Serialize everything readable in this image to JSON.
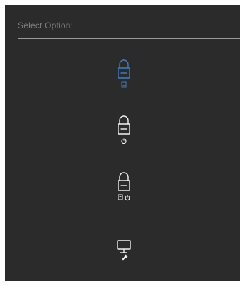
{
  "header": {
    "title": "Select Option:"
  },
  "options": [
    {
      "icon": "lock-menu-icon",
      "selected": true,
      "color": "#3d7ec6"
    },
    {
      "icon": "lock-power-icon",
      "selected": false,
      "color": "#f2f2f2"
    },
    {
      "icon": "lock-menu-power-icon",
      "selected": false,
      "color": "#f2f2f2"
    },
    {
      "icon": "monitor-wrench-icon",
      "selected": false,
      "color": "#f2f2f2"
    }
  ],
  "colors": {
    "panel_background": "#2b2b2b",
    "title_text": "#7d7d7d",
    "accent": "#3d7ec6",
    "icon_default": "#f2f2f2"
  }
}
